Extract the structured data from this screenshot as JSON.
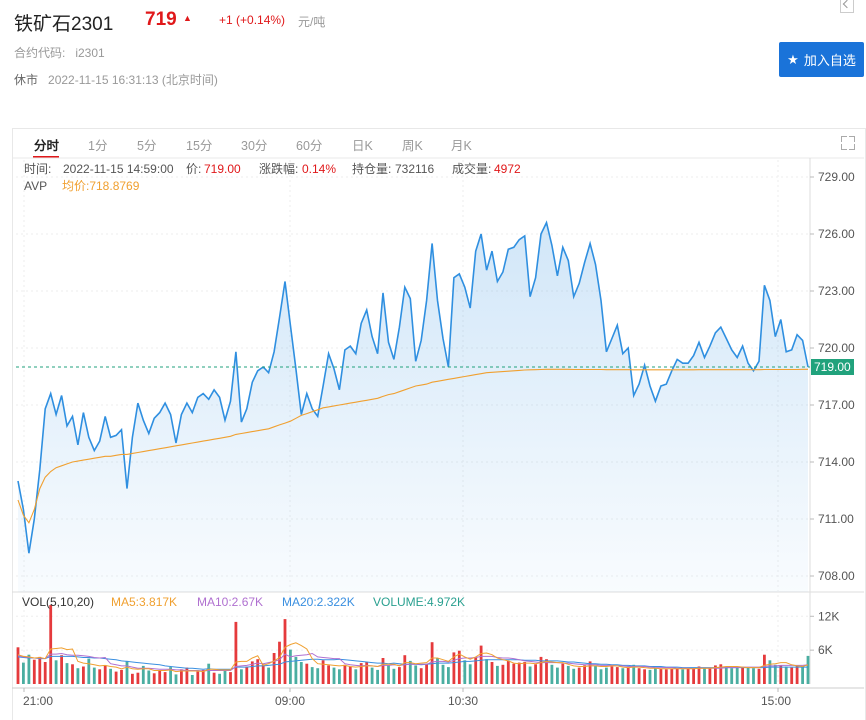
{
  "header": {
    "title": "铁矿石2301",
    "price": "719",
    "arrow": "▲",
    "change": "+1 (+0.14%)",
    "unit": "元/吨",
    "code_label": "合约代码:",
    "code_value": "i2301",
    "status": "休市",
    "datetime": "2022-11-15 16:31:13 (北京时间)",
    "add_button": "加入自选"
  },
  "tabs": [
    "分时",
    "1分",
    "5分",
    "15分",
    "30分",
    "60分",
    "日K",
    "周K",
    "月K"
  ],
  "info": {
    "time_label": "时间:",
    "time_value": "2022-11-15 14:59:00",
    "price_label": "价:",
    "price_value": "719.00",
    "chg_label": "涨跌幅:",
    "chg_value": "0.14%",
    "oi_label": "持仓量:",
    "oi_value": "732116",
    "vol_label": "成交量:",
    "vol_value": "4972",
    "avp_label": "AVP",
    "avp_value": "均价:718.8769"
  },
  "vol_info": {
    "title": "VOL(5,10,20)",
    "ma5": "MA5:3.817K",
    "ma10": "MA10:2.67K",
    "ma20": "MA20:2.322K",
    "volume": "VOLUME:4.972K"
  },
  "colors": {
    "up": "#e0181a",
    "price_line": "#2f8fe0",
    "avg_line": "#f0a030",
    "ma5": "#f0a030",
    "ma10": "#b070d0",
    "ma20": "#3a8fe0",
    "volume": "#2aa090",
    "last_tag": "#21a27c"
  },
  "chart_data": {
    "type": "line",
    "y_ticks": [
      "729.00",
      "726.00",
      "723.00",
      "720.00",
      "717.00",
      "714.00",
      "711.00",
      "708.00"
    ],
    "ylim": [
      707,
      729.5
    ],
    "x_ticks": [
      "21:00",
      "09:00",
      "10:30",
      "15:00"
    ],
    "last_price": 719,
    "last_label": "719.00",
    "price_series": [
      713.0,
      711.5,
      709.2,
      711.0,
      713.6,
      716.8,
      717.6,
      716.5,
      717.5,
      715.9,
      716.4,
      714.9,
      716.6,
      715.3,
      714.6,
      715.1,
      716.4,
      715.3,
      715.4,
      715.7,
      712.6,
      715.3,
      717.1,
      716.2,
      715.5,
      716.3,
      716.6,
      717.1,
      716.5,
      715.0,
      716.5,
      717.1,
      716.6,
      717.4,
      717.6,
      717.3,
      717.8,
      717.4,
      716.2,
      717.2,
      719.8,
      716.1,
      716.8,
      718.2,
      718.8,
      719.0,
      718.7,
      719.8,
      721.6,
      723.5,
      721.2,
      718.9,
      716.5,
      717.6,
      716.8,
      716.4,
      718.0,
      719.7,
      718.9,
      717.8,
      719.9,
      720.1,
      719.7,
      721.3,
      722.0,
      720.6,
      719.7,
      722.9,
      720.3,
      719.4,
      721.1,
      723.2,
      722.6,
      719.3,
      720.4,
      722.5,
      725.5,
      722.5,
      720.5,
      719.0,
      723.7,
      723.9,
      723.2,
      722.1,
      725.1,
      726.0,
      724.1,
      725.1,
      723.5,
      724.0,
      725.2,
      725.3,
      725.7,
      725.9,
      722.7,
      723.7,
      726.0,
      726.6,
      725.4,
      723.8,
      725.3,
      724.6,
      722.7,
      723.4,
      724.5,
      725.5,
      724.4,
      722.5,
      719.8,
      720.5,
      721.2,
      719.7,
      720.0,
      717.5,
      718.1,
      719.1,
      718.0,
      717.2,
      718.0,
      718.1,
      718.8,
      719.4,
      719.2,
      719.2,
      719.6,
      720.3,
      719.5,
      720.1,
      720.8,
      721.1,
      720.5,
      719.9,
      719.5,
      720.1,
      719.2,
      718.8,
      719.3,
      723.3,
      722.5,
      720.6,
      721.5,
      719.8,
      719.9,
      720.7,
      720.4,
      719.0
    ],
    "avg_series": [
      712.0,
      711.2,
      710.8,
      711.5,
      712.6,
      713.2,
      713.5,
      713.7,
      713.8,
      713.9,
      714.0,
      714.05,
      714.1,
      714.15,
      714.2,
      714.25,
      714.3,
      714.3,
      714.35,
      714.4,
      714.4,
      714.45,
      714.5,
      714.55,
      714.6,
      714.65,
      714.7,
      714.75,
      714.8,
      714.85,
      714.9,
      714.95,
      715.0,
      715.05,
      715.1,
      715.15,
      715.2,
      715.25,
      715.3,
      715.35,
      715.45,
      715.5,
      715.55,
      715.6,
      715.65,
      715.7,
      715.75,
      715.85,
      715.95,
      716.05,
      716.15,
      716.3,
      716.45,
      716.55,
      716.65,
      716.75,
      716.85,
      716.9,
      716.95,
      717.0,
      717.05,
      717.1,
      717.15,
      717.2,
      717.25,
      717.3,
      717.35,
      717.45,
      717.55,
      717.6,
      717.7,
      717.8,
      717.9,
      718.0,
      718.05,
      718.1,
      718.2,
      718.25,
      718.3,
      718.35,
      718.4,
      718.45,
      718.5,
      718.55,
      718.6,
      718.65,
      718.7,
      718.72,
      718.74,
      718.76,
      718.78,
      718.8,
      718.82,
      718.84,
      718.85,
      718.86,
      718.87,
      718.88,
      718.88,
      718.88,
      718.88,
      718.88,
      718.87,
      718.87,
      718.87,
      718.87,
      718.87,
      718.87,
      718.86,
      718.86,
      718.86,
      718.86,
      718.86,
      718.85,
      718.85,
      718.85,
      718.85,
      718.85,
      718.85,
      718.85,
      718.85,
      718.85,
      718.85,
      718.85,
      718.85,
      718.86,
      718.86,
      718.86,
      718.86,
      718.86,
      718.86,
      718.86,
      718.86,
      718.86,
      718.86,
      718.86,
      718.86,
      718.87,
      718.87,
      718.87,
      718.87,
      718.87,
      718.87,
      718.87,
      718.877,
      718.877
    ],
    "vol_ticks": [
      "12K",
      "6K"
    ],
    "vol_max": 14000,
    "volume_series": [
      6500,
      3800,
      5200,
      4300,
      4800,
      3900,
      14000,
      4200,
      5100,
      3700,
      3500,
      2800,
      3100,
      4500,
      2900,
      2600,
      3300,
      2700,
      2200,
      2500,
      4100,
      1800,
      2000,
      3200,
      2400,
      1900,
      2300,
      2100,
      3000,
      1700,
      2600,
      2900,
      1600,
      2200,
      2500,
      3600,
      2000,
      1800,
      2400,
      2100,
      11000,
      2600,
      3100,
      4000,
      4400,
      3500,
      2900,
      5500,
      7500,
      11500,
      6100,
      4800,
      3900,
      3600,
      3000,
      2800,
      4200,
      3300,
      2900,
      2600,
      3400,
      3100,
      2600,
      3700,
      3900,
      2900,
      2500,
      4600,
      3300,
      2700,
      3000,
      5100,
      4100,
      3300,
      2800,
      3500,
      7400,
      4600,
      3400,
      3000,
      5600,
      5900,
      4200,
      3500,
      4700,
      6800,
      4400,
      3900,
      3200,
      3400,
      4100,
      3600,
      3800,
      3900,
      3100,
      3500,
      4800,
      4400,
      3400,
      2900,
      3600,
      3200,
      2700,
      2900,
      3300,
      4000,
      3200,
      2600,
      2900,
      3100,
      3000,
      2800,
      2900,
      3400,
      2800,
      2600,
      2500,
      2800,
      2700,
      2600,
      2700,
      2800,
      2600,
      2700,
      2900,
      3100,
      2800,
      2900,
      3300,
      3500,
      3000,
      2800,
      2900,
      3000,
      2900,
      2800,
      2700,
      5200,
      4200,
      3400,
      3300,
      3100,
      2900,
      3200,
      3100,
      4972
    ],
    "ma5_series": [
      5200,
      4900,
      4800,
      4600,
      4700,
      4500,
      6200,
      6300,
      6400,
      6100,
      6200,
      4000,
      3700,
      3600,
      3400,
      3200,
      3300,
      3100,
      3000,
      2700,
      3000,
      2700,
      2600,
      2700,
      2700,
      2400,
      2400,
      2400,
      2500,
      2200,
      2300,
      2300,
      2300,
      2300,
      2200,
      2600,
      2600,
      2500,
      2500,
      2500,
      3900,
      4000,
      4000,
      4600,
      5000,
      3300,
      3600,
      4100,
      4700,
      6500,
      7000,
      7300,
      6800,
      6200,
      4500,
      3600,
      3500,
      3400,
      3300,
      3200,
      3300,
      3100,
      3000,
      3100,
      3200,
      3200,
      3100,
      3500,
      3500,
      3500,
      3200,
      3800,
      3800,
      3600,
      3700,
      3800,
      4600,
      4600,
      4300,
      4000,
      4800,
      5300,
      4800,
      4400,
      4800,
      5400,
      5500,
      5200,
      4600,
      4300,
      4100,
      3700,
      3600,
      3700,
      3700,
      3600,
      3800,
      4000,
      3900,
      3800,
      3800,
      3500,
      3200,
      3100,
      3100,
      3200,
      3200,
      3100,
      3100,
      3200,
      3200,
      3000,
      2900,
      3000,
      3000,
      2900,
      2800,
      2800,
      2700,
      2700,
      2700,
      2700,
      2700,
      2700,
      2700,
      2800,
      2800,
      2800,
      2900,
      3000,
      3100,
      3100,
      3100,
      3000,
      2900,
      2900,
      2900,
      3300,
      3500,
      3600,
      3800,
      3800,
      3400,
      3200,
      3100,
      3400
    ],
    "ma10_series": [
      5000,
      4800,
      4700,
      4600,
      4600,
      4500,
      5300,
      5300,
      5400,
      5200,
      5100,
      5100,
      5000,
      4900,
      4700,
      4600,
      4700,
      3600,
      3400,
      3200,
      3200,
      3000,
      2800,
      2800,
      2800,
      2700,
      2600,
      2600,
      2600,
      2500,
      2500,
      2400,
      2400,
      2400,
      2300,
      2400,
      2400,
      2400,
      2400,
      2400,
      3100,
      3200,
      3300,
      3500,
      3700,
      3600,
      3800,
      4000,
      4300,
      5300,
      4800,
      5000,
      5100,
      5200,
      5400,
      4800,
      4700,
      4600,
      4500,
      4500,
      3600,
      3400,
      3300,
      3200,
      3300,
      3200,
      3100,
      3300,
      3300,
      3400,
      3300,
      3400,
      3500,
      3500,
      3500,
      3500,
      3900,
      4000,
      4000,
      3900,
      4200,
      4500,
      4600,
      4600,
      4700,
      4900,
      4900,
      4900,
      4700,
      4600,
      4600,
      4500,
      4300,
      4100,
      4000,
      3900,
      3800,
      3800,
      3800,
      3800,
      3700,
      3700,
      3600,
      3500,
      3400,
      3400,
      3400,
      3300,
      3300,
      3300,
      3200,
      3200,
      3100,
      3100,
      3100,
      3100,
      3000,
      2900,
      2900,
      2900,
      2900,
      2800,
      2800,
      2800,
      2700,
      2800,
      2800,
      2800,
      2800,
      2800,
      2900,
      2900,
      2900,
      3000,
      3000,
      3000,
      3000,
      3100,
      3200,
      3200,
      3300,
      3300,
      3300,
      3300,
      3300,
      3400
    ],
    "ma20_series": [
      4800,
      4700,
      4600,
      4600,
      4500,
      4500,
      4900,
      4900,
      4900,
      4900,
      4900,
      4800,
      4700,
      4700,
      4600,
      4600,
      4500,
      4400,
      4300,
      4100,
      4000,
      3900,
      3800,
      3700,
      3600,
      3500,
      3400,
      3200,
      3100,
      3000,
      2900,
      2800,
      2800,
      2700,
      2600,
      2700,
      2600,
      2600,
      2600,
      2600,
      3000,
      3000,
      3000,
      3100,
      3200,
      3200,
      3300,
      3400,
      3500,
      3900,
      4000,
      4100,
      4200,
      4300,
      4400,
      4400,
      4300,
      4300,
      4300,
      4400,
      4300,
      4200,
      4100,
      4000,
      3900,
      3800,
      3700,
      3700,
      3600,
      3700,
      3600,
      3500,
      3500,
      3500,
      3400,
      3500,
      3600,
      3700,
      3700,
      3700,
      3800,
      3900,
      4000,
      4000,
      4100,
      4200,
      4300,
      4300,
      4300,
      4300,
      4300,
      4300,
      4300,
      4200,
      4200,
      4200,
      4100,
      4100,
      4100,
      4100,
      4000,
      3900,
      3900,
      3800,
      3700,
      3600,
      3600,
      3500,
      3500,
      3400,
      3400,
      3300,
      3300,
      3200,
      3200,
      3200,
      3100,
      3100,
      3100,
      3000,
      3000,
      3000,
      2900,
      2900,
      2900,
      2900,
      2900,
      2900,
      2900,
      2900,
      2900,
      2900,
      2900,
      2900,
      2900,
      2900,
      2900,
      2900,
      3000,
      3000,
      3000,
      3000,
      3000,
      3000,
      3000,
      3000
    ]
  }
}
